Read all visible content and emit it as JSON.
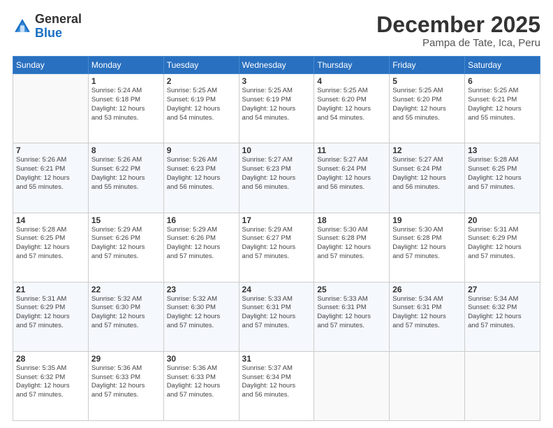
{
  "logo": {
    "general": "General",
    "blue": "Blue"
  },
  "title": "December 2025",
  "subtitle": "Pampa de Tate, Ica, Peru",
  "days_of_week": [
    "Sunday",
    "Monday",
    "Tuesday",
    "Wednesday",
    "Thursday",
    "Friday",
    "Saturday"
  ],
  "weeks": [
    [
      {
        "day": "",
        "info": ""
      },
      {
        "day": "1",
        "info": "Sunrise: 5:24 AM\nSunset: 6:18 PM\nDaylight: 12 hours\nand 53 minutes."
      },
      {
        "day": "2",
        "info": "Sunrise: 5:25 AM\nSunset: 6:19 PM\nDaylight: 12 hours\nand 54 minutes."
      },
      {
        "day": "3",
        "info": "Sunrise: 5:25 AM\nSunset: 6:19 PM\nDaylight: 12 hours\nand 54 minutes."
      },
      {
        "day": "4",
        "info": "Sunrise: 5:25 AM\nSunset: 6:20 PM\nDaylight: 12 hours\nand 54 minutes."
      },
      {
        "day": "5",
        "info": "Sunrise: 5:25 AM\nSunset: 6:20 PM\nDaylight: 12 hours\nand 55 minutes."
      },
      {
        "day": "6",
        "info": "Sunrise: 5:25 AM\nSunset: 6:21 PM\nDaylight: 12 hours\nand 55 minutes."
      }
    ],
    [
      {
        "day": "7",
        "info": ""
      },
      {
        "day": "8",
        "info": "Sunrise: 5:26 AM\nSunset: 6:22 PM\nDaylight: 12 hours\nand 55 minutes."
      },
      {
        "day": "9",
        "info": "Sunrise: 5:26 AM\nSunset: 6:23 PM\nDaylight: 12 hours\nand 56 minutes."
      },
      {
        "day": "10",
        "info": "Sunrise: 5:27 AM\nSunset: 6:23 PM\nDaylight: 12 hours\nand 56 minutes."
      },
      {
        "day": "11",
        "info": "Sunrise: 5:27 AM\nSunset: 6:24 PM\nDaylight: 12 hours\nand 56 minutes."
      },
      {
        "day": "12",
        "info": "Sunrise: 5:27 AM\nSunset: 6:24 PM\nDaylight: 12 hours\nand 56 minutes."
      },
      {
        "day": "13",
        "info": "Sunrise: 5:28 AM\nSunset: 6:25 PM\nDaylight: 12 hours\nand 57 minutes."
      }
    ],
    [
      {
        "day": "14",
        "info": ""
      },
      {
        "day": "15",
        "info": "Sunrise: 5:29 AM\nSunset: 6:26 PM\nDaylight: 12 hours\nand 57 minutes."
      },
      {
        "day": "16",
        "info": "Sunrise: 5:29 AM\nSunset: 6:26 PM\nDaylight: 12 hours\nand 57 minutes."
      },
      {
        "day": "17",
        "info": "Sunrise: 5:29 AM\nSunset: 6:27 PM\nDaylight: 12 hours\nand 57 minutes."
      },
      {
        "day": "18",
        "info": "Sunrise: 5:30 AM\nSunset: 6:28 PM\nDaylight: 12 hours\nand 57 minutes."
      },
      {
        "day": "19",
        "info": "Sunrise: 5:30 AM\nSunset: 6:28 PM\nDaylight: 12 hours\nand 57 minutes."
      },
      {
        "day": "20",
        "info": "Sunrise: 5:31 AM\nSunset: 6:29 PM\nDaylight: 12 hours\nand 57 minutes."
      }
    ],
    [
      {
        "day": "21",
        "info": ""
      },
      {
        "day": "22",
        "info": "Sunrise: 5:32 AM\nSunset: 6:30 PM\nDaylight: 12 hours\nand 57 minutes."
      },
      {
        "day": "23",
        "info": "Sunrise: 5:32 AM\nSunset: 6:30 PM\nDaylight: 12 hours\nand 57 minutes."
      },
      {
        "day": "24",
        "info": "Sunrise: 5:33 AM\nSunset: 6:31 PM\nDaylight: 12 hours\nand 57 minutes."
      },
      {
        "day": "25",
        "info": "Sunrise: 5:33 AM\nSunset: 6:31 PM\nDaylight: 12 hours\nand 57 minutes."
      },
      {
        "day": "26",
        "info": "Sunrise: 5:34 AM\nSunset: 6:31 PM\nDaylight: 12 hours\nand 57 minutes."
      },
      {
        "day": "27",
        "info": "Sunrise: 5:34 AM\nSunset: 6:32 PM\nDaylight: 12 hours\nand 57 minutes."
      }
    ],
    [
      {
        "day": "28",
        "info": "Sunrise: 5:35 AM\nSunset: 6:32 PM\nDaylight: 12 hours\nand 57 minutes."
      },
      {
        "day": "29",
        "info": "Sunrise: 5:36 AM\nSunset: 6:33 PM\nDaylight: 12 hours\nand 57 minutes."
      },
      {
        "day": "30",
        "info": "Sunrise: 5:36 AM\nSunset: 6:33 PM\nDaylight: 12 hours\nand 57 minutes."
      },
      {
        "day": "31",
        "info": "Sunrise: 5:37 AM\nSunset: 6:34 PM\nDaylight: 12 hours\nand 56 minutes."
      },
      {
        "day": "",
        "info": ""
      },
      {
        "day": "",
        "info": ""
      },
      {
        "day": "",
        "info": ""
      }
    ]
  ],
  "week1_day7_info": "Sunrise: 5:26 AM\nSunset: 6:21 PM\nDaylight: 12 hours\nand 55 minutes.",
  "week2_day14_info": "Sunrise: 5:28 AM\nSunset: 6:25 PM\nDaylight: 12 hours\nand 57 minutes.",
  "week3_day21_info": "Sunrise: 5:31 AM\nSunset: 6:29 PM\nDaylight: 12 hours\nand 57 minutes."
}
